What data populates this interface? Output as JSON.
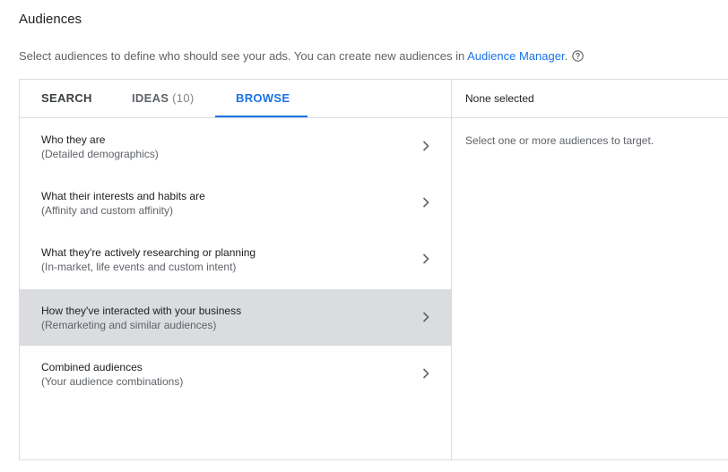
{
  "header": {
    "title": "Audiences",
    "description": "Select audiences to define who should see your ads. You can create new audiences in ",
    "link_text": "Audience Manager",
    "after_link": ".",
    "help_icon": "help-circle-icon"
  },
  "tabs": {
    "search": "SEARCH",
    "ideas": "IDEAS",
    "ideas_count": "(10)",
    "browse": "BROWSE",
    "active": "BROWSE",
    "accent_color": "#1a73e8"
  },
  "browse_items": [
    {
      "label": "Who they are",
      "sub": "(Detailed demographics)",
      "icon": "chevron-right-icon"
    },
    {
      "label": "What their interests and habits are",
      "sub": "(Affinity and custom affinity)",
      "icon": "chevron-right-icon"
    },
    {
      "label": "What they're actively researching or planning",
      "sub": "(In-market, life events and custom intent)",
      "icon": "chevron-right-icon"
    },
    {
      "label": "How they've interacted with your business",
      "sub": "(Remarketing and similar audiences)",
      "icon": "chevron-right-icon",
      "highlighted": true
    },
    {
      "label": "Combined audiences",
      "sub": "(Your audience combinations)",
      "icon": "chevron-right-icon"
    }
  ],
  "selection_panel": {
    "header": "None selected",
    "empty_text": "Select one or more audiences to target."
  }
}
